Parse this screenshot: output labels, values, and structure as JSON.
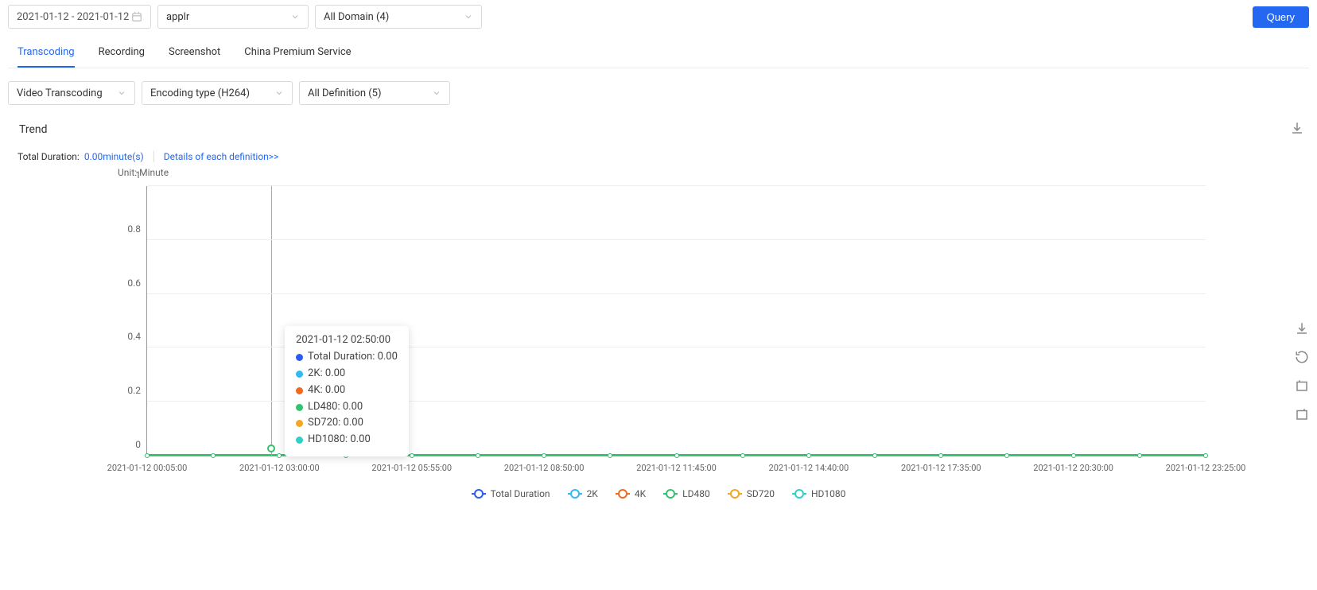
{
  "header": {
    "date_range": "2021-01-12 - 2021-01-12",
    "app_select": "applr",
    "domain_select": "All Domain (4)",
    "query_button": "Query"
  },
  "tabs": [
    {
      "label": "Transcoding",
      "active": true
    },
    {
      "label": "Recording",
      "active": false
    },
    {
      "label": "Screenshot",
      "active": false
    },
    {
      "label": "China Premium Service",
      "active": false
    }
  ],
  "filters": {
    "video_transcoding": "Video Transcoding",
    "encoding_type": "Encoding type (H264)",
    "all_definition": "All Definition (5)"
  },
  "trend_title": "Trend",
  "duration": {
    "label": "Total Duration:",
    "value": "0.00minute(s)",
    "details_link": "Details of each definition>>"
  },
  "unit_label": "Unit: Minute",
  "tooltip": {
    "time": "2021-01-12 02:50:00",
    "items": [
      {
        "label": "Total Duration",
        "value": "0.00",
        "color": "#2b5cf2"
      },
      {
        "label": "2K",
        "value": "0.00",
        "color": "#33b8f3"
      },
      {
        "label": "4K",
        "value": "0.00",
        "color": "#f06a1f"
      },
      {
        "label": "LD480",
        "value": "0.00",
        "color": "#35c26e"
      },
      {
        "label": "SD720",
        "value": "0.00",
        "color": "#f5a623"
      },
      {
        "label": "HD1080",
        "value": "0.00",
        "color": "#2fd0c6"
      }
    ]
  },
  "legend": [
    {
      "label": "Total Duration",
      "color": "#2b5cf2"
    },
    {
      "label": "2K",
      "color": "#33b8f3"
    },
    {
      "label": "4K",
      "color": "#f06a1f"
    },
    {
      "label": "LD480",
      "color": "#35c26e"
    },
    {
      "label": "SD720",
      "color": "#f5a623"
    },
    {
      "label": "HD1080",
      "color": "#2fd0c6"
    }
  ],
  "chart_data": {
    "type": "line",
    "title": "Trend",
    "xlabel": "",
    "ylabel": "Minute",
    "ylim": [
      0,
      1
    ],
    "yticks": [
      0,
      0.2,
      0.4,
      0.6,
      0.8,
      1
    ],
    "categories": [
      "2021-01-12 00:05:00",
      "2021-01-12 03:00:00",
      "2021-01-12 05:55:00",
      "2021-01-12 08:50:00",
      "2021-01-12 11:45:00",
      "2021-01-12 14:40:00",
      "2021-01-12 17:35:00",
      "2021-01-12 20:30:00",
      "2021-01-12 23:25:00"
    ],
    "series": [
      {
        "name": "Total Duration",
        "color": "#2b5cf2",
        "values": [
          0,
          0,
          0,
          0,
          0,
          0,
          0,
          0,
          0
        ]
      },
      {
        "name": "2K",
        "color": "#33b8f3",
        "values": [
          0,
          0,
          0,
          0,
          0,
          0,
          0,
          0,
          0
        ]
      },
      {
        "name": "4K",
        "color": "#f06a1f",
        "values": [
          0,
          0,
          0,
          0,
          0,
          0,
          0,
          0,
          0
        ]
      },
      {
        "name": "LD480",
        "color": "#35c26e",
        "values": [
          0,
          0,
          0,
          0,
          0,
          0,
          0,
          0,
          0
        ]
      },
      {
        "name": "SD720",
        "color": "#f5a623",
        "values": [
          0,
          0,
          0,
          0,
          0,
          0,
          0,
          0,
          0
        ]
      },
      {
        "name": "HD1080",
        "color": "#2fd0c6",
        "values": [
          0,
          0,
          0,
          0,
          0,
          0,
          0,
          0,
          0
        ]
      }
    ]
  }
}
